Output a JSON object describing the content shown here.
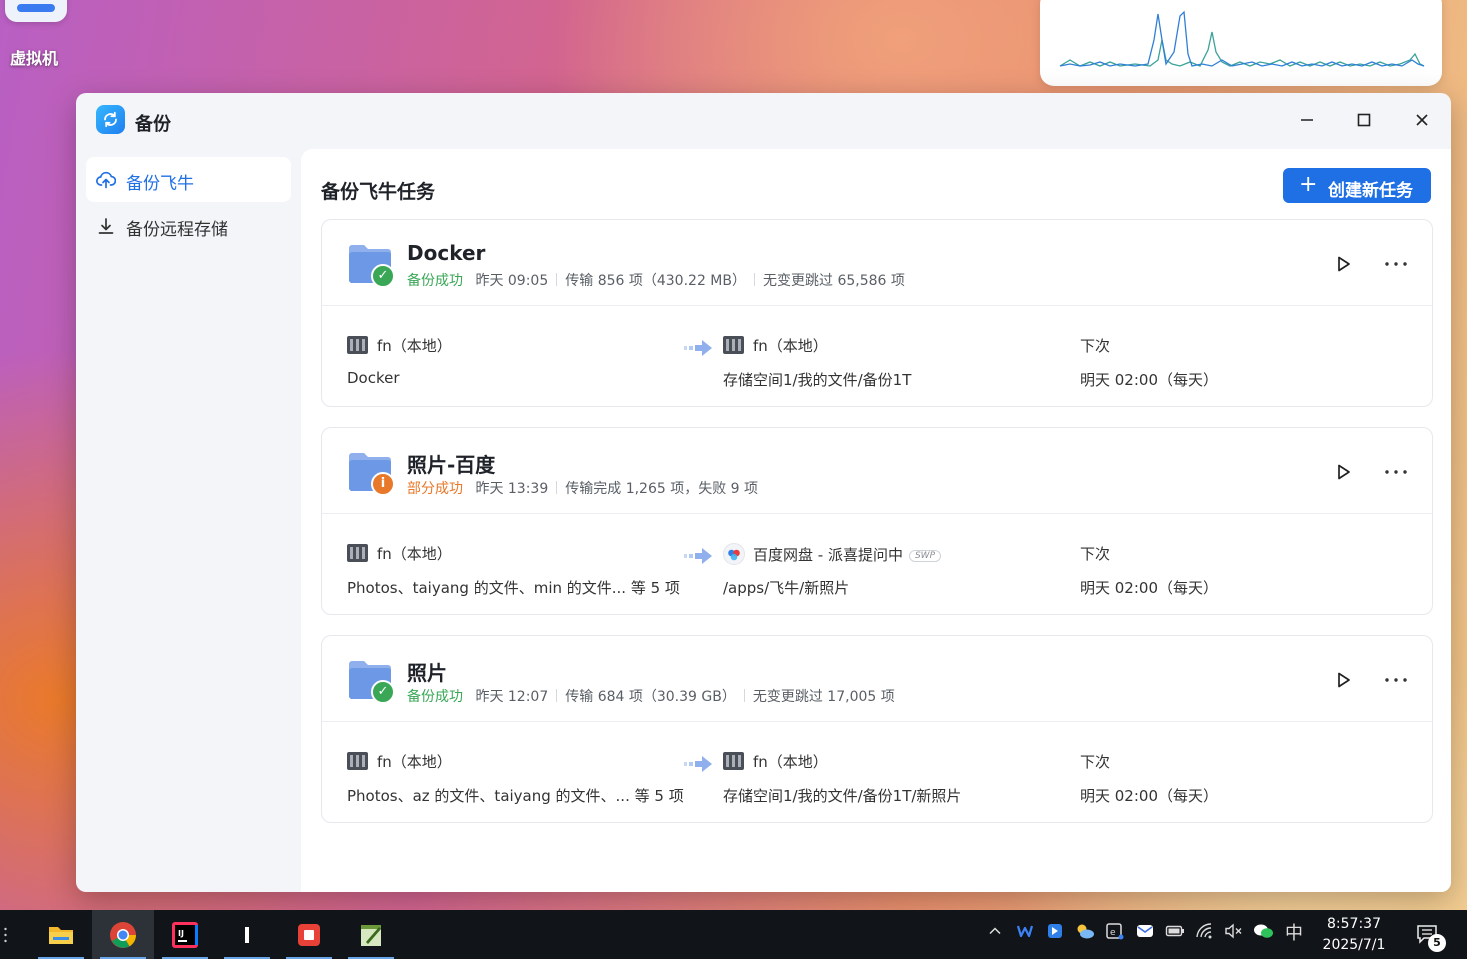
{
  "desktop": {
    "icon_label": "虚拟机"
  },
  "window": {
    "title": "备份"
  },
  "sidebar": {
    "items": [
      {
        "label": "备份飞牛",
        "active": true,
        "icon": "cloud-upload-icon"
      },
      {
        "label": "备份远程存储",
        "active": false,
        "icon": "download-icon"
      }
    ]
  },
  "main": {
    "title": "备份飞牛任务",
    "create_button": "创建新任务",
    "next_label": "下次",
    "tasks": [
      {
        "name": "Docker",
        "status": "备份成功",
        "status_type": "success",
        "time": "昨天 09:05",
        "transfer": "传输 856 项（430.22 MB）",
        "extra": "无变更跳过 65,586 项",
        "source_device": "fn（本地）",
        "source_path": "Docker",
        "dest_device": "fn（本地）",
        "dest_path": "存储空间1/我的文件/备份1T",
        "next_time": "明天 02:00（每天）"
      },
      {
        "name": "照片-百度",
        "status": "部分成功",
        "status_type": "partial",
        "time": "昨天 13:39",
        "transfer": "传输完成 1,265 项，失败 9 项",
        "extra": "",
        "source_device": "fn（本地）",
        "source_path": "Photos、taiyang 的文件、min 的文件... 等 5 项",
        "dest_device": "百度网盘 - 派喜提问中",
        "dest_tag": "SWP",
        "dest_path": "/apps/飞牛/新照片",
        "next_time": "明天 02:00（每天）"
      },
      {
        "name": "照片",
        "status": "备份成功",
        "status_type": "success",
        "time": "昨天 12:07",
        "transfer": "传输 684 项（30.39 GB）",
        "extra": "无变更跳过 17,005 项",
        "source_device": "fn（本地）",
        "source_path": "Photos、az 的文件、taiyang 的文件、... 等 5 项",
        "dest_device": "fn（本地）",
        "dest_path": "存储空间1/我的文件/备份1T/新照片",
        "next_time": "明天 02:00（每天）"
      }
    ]
  },
  "taskbar": {
    "ime": "中",
    "time": "8:57:37",
    "date": "2025/7/1",
    "notification_count": "5"
  },
  "colors": {
    "accent": "#1f6fe5",
    "success": "#3aa757",
    "warning": "#e8782a"
  }
}
